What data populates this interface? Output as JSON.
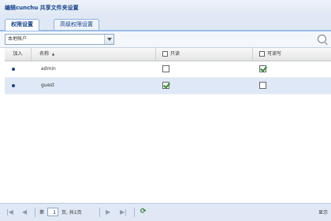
{
  "window": {
    "title": "编辑cunchu 共享文件夹设置"
  },
  "tabs": [
    {
      "label": "权限设置",
      "active": true
    },
    {
      "label": "高级权限设置",
      "active": false
    }
  ],
  "toolbar": {
    "combo_value": "本地帐户",
    "search_icon": "search-icon"
  },
  "grid": {
    "headers": {
      "add": "加入",
      "name": "名称",
      "sort_indicator": "▲",
      "readonly": "只读",
      "readwrite": "可读写"
    },
    "rows": [
      {
        "selected": false,
        "added": true,
        "name": "admin",
        "readonly": false,
        "readwrite": true
      },
      {
        "selected": true,
        "added": true,
        "name": "guest",
        "readonly": true,
        "readwrite": false
      }
    ]
  },
  "pager": {
    "page_label": "第",
    "page_value": "1",
    "page_of": "页, 共1页",
    "status": "显示"
  }
}
